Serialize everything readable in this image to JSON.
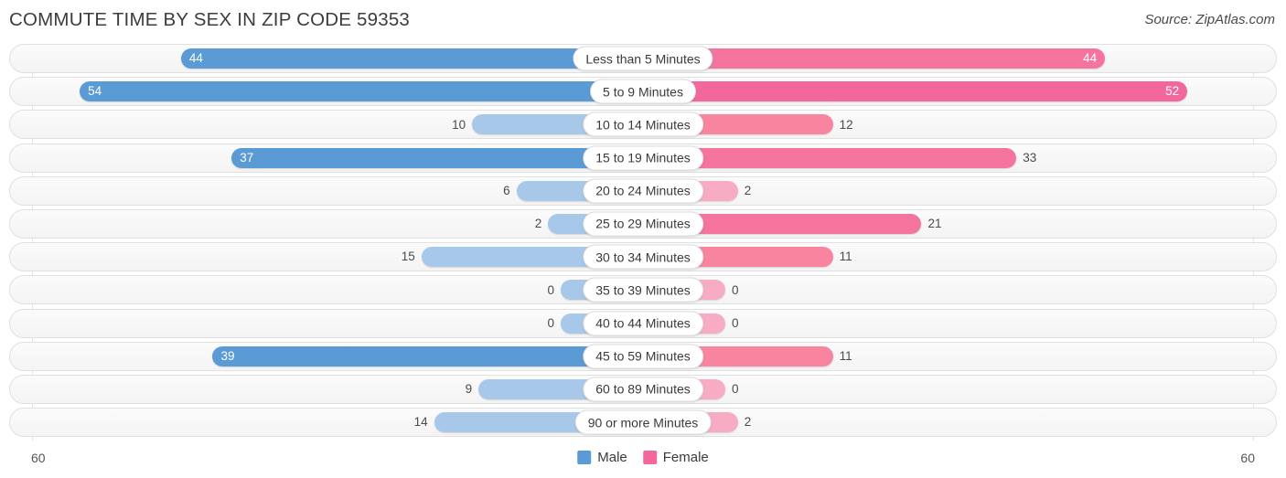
{
  "header": {
    "title": "COMMUTE TIME BY SEX IN ZIP CODE 59353",
    "source": "Source: ZipAtlas.com"
  },
  "legend": {
    "male_label": "Male",
    "female_label": "Female",
    "male_color": "#5B9BD5",
    "female_color": "#F2689C"
  },
  "axis": {
    "left_label": "60",
    "right_label": "60",
    "max": 60
  },
  "colors": {
    "male_strong": "#5B9BD5",
    "male_light": "#A8C8EA",
    "female_strong": "#F2689C",
    "female_mid": "#F4749E",
    "female_light": "#F8ACC4",
    "track_border": "#e0e0e0",
    "label_text": "#4a4a4a"
  },
  "chart_data": {
    "type": "bar",
    "subtype": "diverging-population-pyramid",
    "title": "COMMUTE TIME BY SEX IN ZIP CODE 59353",
    "xlabel": "",
    "ylabel": "",
    "xlim": [
      60,
      60
    ],
    "grid": false,
    "legend_position": "bottom-center",
    "categories": [
      "Less than 5 Minutes",
      "5 to 9 Minutes",
      "10 to 14 Minutes",
      "15 to 19 Minutes",
      "20 to 24 Minutes",
      "25 to 29 Minutes",
      "30 to 34 Minutes",
      "35 to 39 Minutes",
      "40 to 44 Minutes",
      "45 to 59 Minutes",
      "60 to 89 Minutes",
      "90 or more Minutes"
    ],
    "series": [
      {
        "name": "Male",
        "side": "left",
        "values": [
          44,
          54,
          10,
          37,
          6,
          2,
          15,
          0,
          0,
          39,
          9,
          14
        ]
      },
      {
        "name": "Female",
        "side": "right",
        "values": [
          44,
          52,
          12,
          33,
          2,
          21,
          11,
          0,
          0,
          11,
          0,
          2
        ]
      }
    ]
  },
  "rows": [
    {
      "category": "Less than 5 Minutes",
      "male": "44",
      "female": "44",
      "male_pct": 73,
      "female_pct": 73,
      "male_inside": true,
      "female_inside": true,
      "male_color": "#5B9BD5",
      "female_color": "#F4749E"
    },
    {
      "category": "5 to 9 Minutes",
      "male": "54",
      "female": "52",
      "male_pct": 89,
      "female_pct": 86,
      "male_inside": true,
      "female_inside": true,
      "male_color": "#5B9BD5",
      "female_color": "#F2689C"
    },
    {
      "category": "10 to 14 Minutes",
      "male": "10",
      "female": "12",
      "male_pct": 27,
      "female_pct": 30,
      "male_inside": false,
      "female_inside": false,
      "male_color": "#A8C8EA",
      "female_color": "#F8849F"
    },
    {
      "category": "15 to 19 Minutes",
      "male": "37",
      "female": "33",
      "male_pct": 65,
      "female_pct": 59,
      "male_inside": true,
      "female_inside": false,
      "male_color": "#5B9BD5",
      "female_color": "#F4749E"
    },
    {
      "category": "20 to 24 Minutes",
      "male": "6",
      "female": "2",
      "male_pct": 20,
      "female_pct": 15,
      "male_inside": false,
      "female_inside": false,
      "male_color": "#A8C8EA",
      "female_color": "#F8ACC4"
    },
    {
      "category": "25 to 29 Minutes",
      "male": "2",
      "female": "21",
      "male_pct": 15,
      "female_pct": 44,
      "male_inside": false,
      "female_inside": false,
      "male_color": "#A8C8EA",
      "female_color": "#F4749E"
    },
    {
      "category": "30 to 34 Minutes",
      "male": "15",
      "female": "11",
      "male_pct": 35,
      "female_pct": 30,
      "male_inside": false,
      "female_inside": false,
      "male_color": "#A8C8EA",
      "female_color": "#F8849F"
    },
    {
      "category": "35 to 39 Minutes",
      "male": "0",
      "female": "0",
      "male_pct": 13,
      "female_pct": 13,
      "male_inside": false,
      "female_inside": false,
      "male_color": "#A8C8EA",
      "female_color": "#F8ACC4"
    },
    {
      "category": "40 to 44 Minutes",
      "male": "0",
      "female": "0",
      "male_pct": 13,
      "female_pct": 13,
      "male_inside": false,
      "female_inside": false,
      "male_color": "#A8C8EA",
      "female_color": "#F8ACC4"
    },
    {
      "category": "45 to 59 Minutes",
      "male": "39",
      "female": "11",
      "male_pct": 68,
      "female_pct": 30,
      "male_inside": true,
      "female_inside": false,
      "male_color": "#5B9BD5",
      "female_color": "#F8849F"
    },
    {
      "category": "60 to 89 Minutes",
      "male": "9",
      "female": "0",
      "male_pct": 26,
      "female_pct": 13,
      "male_inside": false,
      "female_inside": false,
      "male_color": "#A8C8EA",
      "female_color": "#F8ACC4"
    },
    {
      "category": "90 or more Minutes",
      "male": "14",
      "female": "2",
      "male_pct": 33,
      "female_pct": 15,
      "male_inside": false,
      "female_inside": false,
      "male_color": "#A8C8EA",
      "female_color": "#F8ACC4"
    }
  ]
}
